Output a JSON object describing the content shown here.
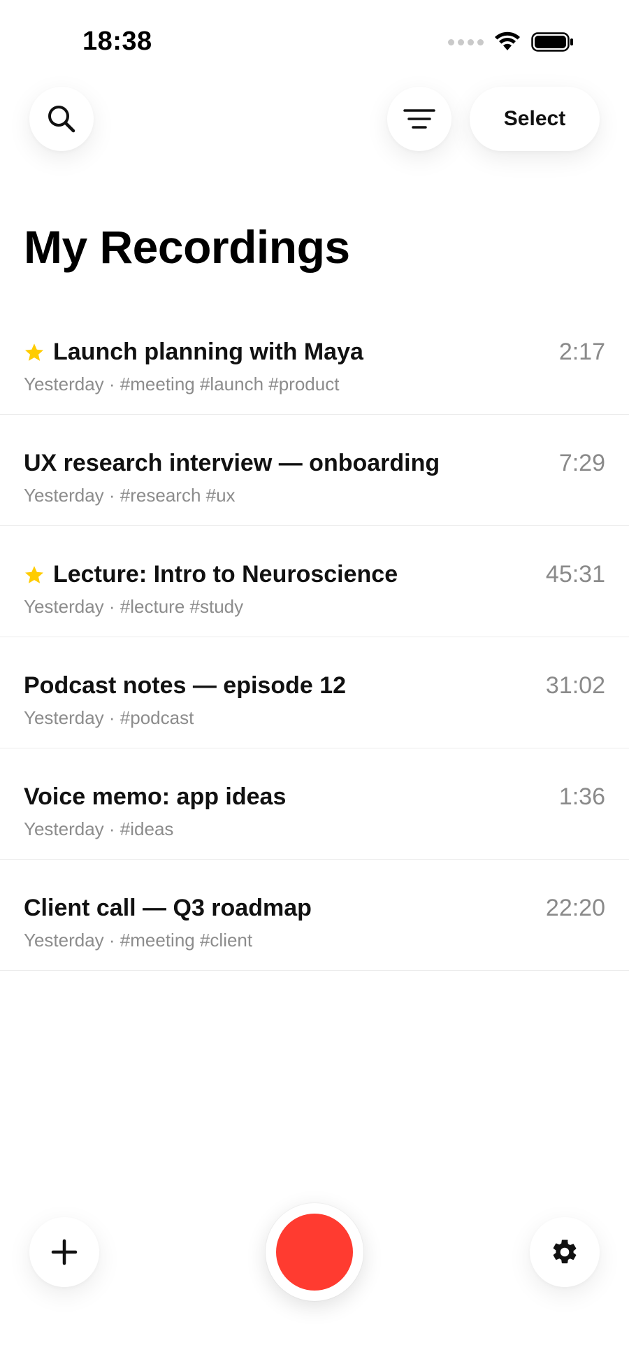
{
  "status_bar": {
    "time": "18:38"
  },
  "header": {
    "select_label": "Select"
  },
  "title": "My Recordings",
  "colors": {
    "accent_record": "#ff3b30",
    "star": "#ffcc00",
    "meta_text": "#8c8c8c"
  },
  "recordings": [
    {
      "title": "Launch planning with Maya",
      "meta": "Yesterday · #meeting #launch #product",
      "duration": "2:17",
      "starred": true
    },
    {
      "title": "UX research interview — onboarding",
      "meta": "Yesterday · #research #ux",
      "duration": "7:29",
      "starred": false
    },
    {
      "title": "Lecture: Intro to Neuroscience",
      "meta": "Yesterday · #lecture #study",
      "duration": "45:31",
      "starred": true
    },
    {
      "title": "Podcast notes — episode 12",
      "meta": "Yesterday · #podcast",
      "duration": "31:02",
      "starred": false
    },
    {
      "title": "Voice memo: app ideas",
      "meta": "Yesterday · #ideas",
      "duration": "1:36",
      "starred": false
    },
    {
      "title": "Client call — Q3 roadmap",
      "meta": "Yesterday · #meeting #client",
      "duration": "22:20",
      "starred": false
    }
  ],
  "icons": {
    "search": "search-icon",
    "filter": "filter-icon",
    "add": "plus-icon",
    "record": "record-icon",
    "settings": "gear-icon",
    "star": "star-icon"
  }
}
